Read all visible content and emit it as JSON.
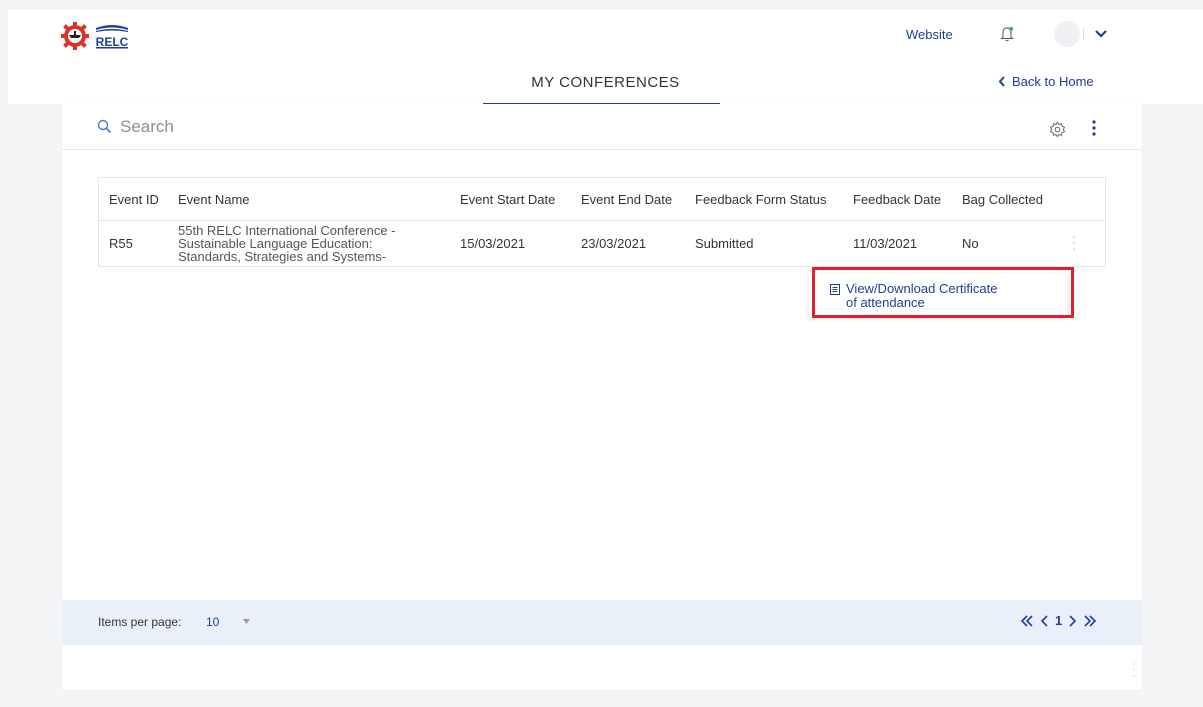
{
  "header": {
    "logo_text": "RELC",
    "website_label": "Website",
    "icons": [
      "gear-logo-icon",
      "bell-icon",
      "avatar",
      "chevron-down-icon"
    ]
  },
  "titlebar": {
    "title": "MY CONFERENCES",
    "back_label": "Back to Home"
  },
  "search": {
    "placeholder": "Search"
  },
  "table": {
    "headers": {
      "event_id": "Event ID",
      "event_name": "Event Name",
      "start_date": "Event Start Date",
      "end_date": "Event End Date",
      "feedback_status": "Feedback Form Status",
      "feedback_date": "Feedback Date",
      "bag_collected": "Bag Collected"
    },
    "rows": [
      {
        "event_id": "R55",
        "event_name_line1": "55th RELC International Conference -",
        "event_name_line2": "Sustainable Language Education:",
        "event_name_line3": "Standards, Strategies and Systems-",
        "start_date": "15/03/2021",
        "end_date": "23/03/2021",
        "feedback_status": "Submitted",
        "feedback_date": "11/03/2021",
        "bag_collected": "No"
      }
    ]
  },
  "menu": {
    "item_line1": "View/Download Certificate",
    "item_line2": "of attendance"
  },
  "footer": {
    "items_per_page_label": "Items per page:",
    "items_per_page_value": "10",
    "current_page": "1"
  },
  "colors": {
    "accent": "#1f3d99",
    "highlight": "#e0202a",
    "footer_bg": "#eaf0f9"
  }
}
